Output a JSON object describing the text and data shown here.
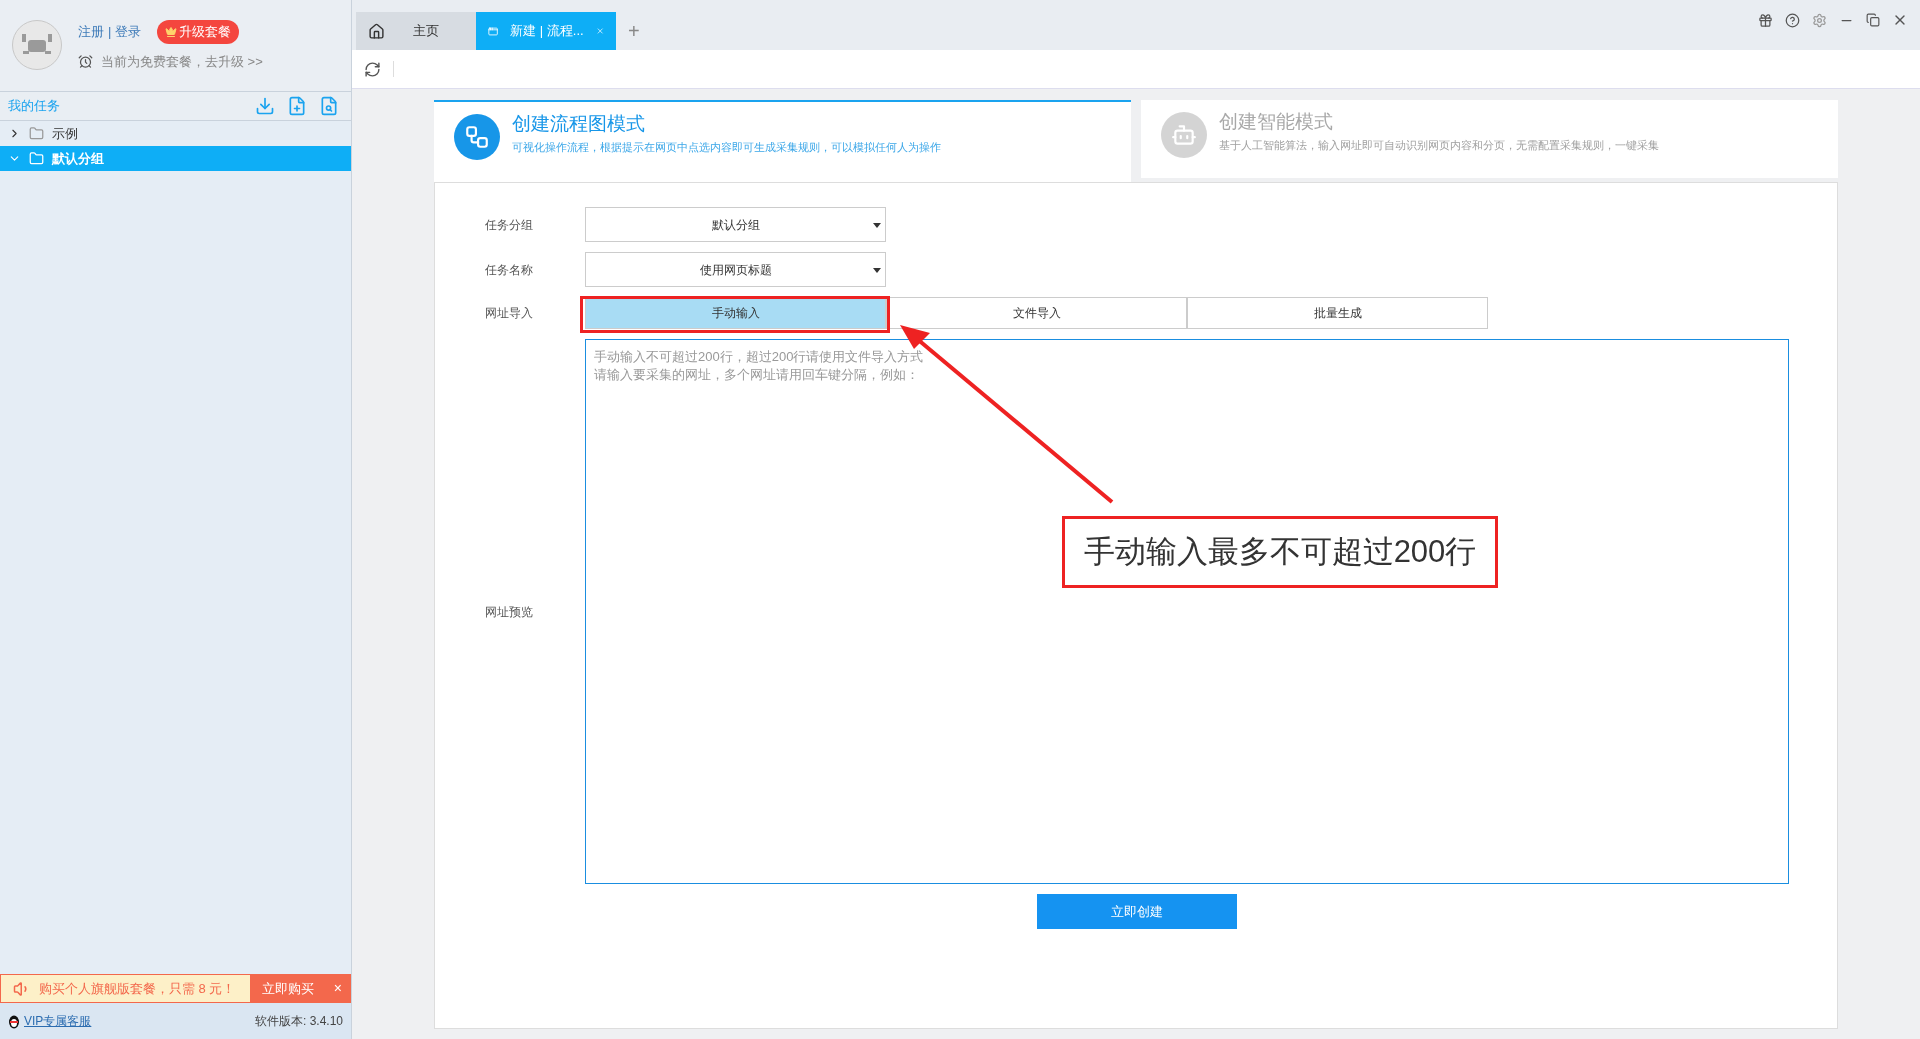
{
  "account": {
    "register": "注册",
    "separator": "|",
    "login": "登录",
    "upgrade_button": "升级套餐",
    "plan_notice": "当前为免费套餐，去升级 >>"
  },
  "task_panel": {
    "title": "我的任务"
  },
  "tree": [
    {
      "label": "示例",
      "expanded": false,
      "selected": false
    },
    {
      "label": "默认分组",
      "expanded": true,
      "selected": true
    }
  ],
  "promo": {
    "text": "购买个人旗舰版套餐，只需 8 元！",
    "button": "立即购买",
    "close": "×"
  },
  "footer": {
    "support_link": "VIP专属客服",
    "version": "软件版本: 3.4.10"
  },
  "tabs": [
    {
      "kind": "home",
      "label": "主页",
      "selected": false,
      "closable": false
    },
    {
      "kind": "page",
      "label": "新建 | 流程...",
      "selected": true,
      "closable": true
    }
  ],
  "new_tab": "+",
  "modes": [
    {
      "kind": "flow",
      "title": "创建流程图模式",
      "description": "可视化操作流程，根据提示在网页中点选内容即可生成采集规则，可以模拟任何人为操作",
      "selected": true
    },
    {
      "kind": "smart",
      "title": "创建智能模式",
      "description": "基于人工智能算法，输入网址即可自动识别网页内容和分页，无需配置采集规则，一键采集",
      "selected": false
    }
  ],
  "form": {
    "group_label": "任务分组",
    "group_value": "默认分组",
    "name_label": "任务名称",
    "name_value": "使用网页标题",
    "import_label": "网址导入",
    "import_tabs": [
      {
        "label": "手动输入",
        "selected": true
      },
      {
        "label": "文件导入",
        "selected": false
      },
      {
        "label": "批量生成",
        "selected": false
      }
    ],
    "url_placeholder": [
      "手动输入不可超过200行，超过200行请使用文件导入方式",
      "请输入要采集的网址，多个网址请用回车键分隔，例如："
    ],
    "preview_label": "网址预览",
    "create_button": "立即创建"
  },
  "annotation": {
    "text": "手动输入最多不可超过200行"
  }
}
